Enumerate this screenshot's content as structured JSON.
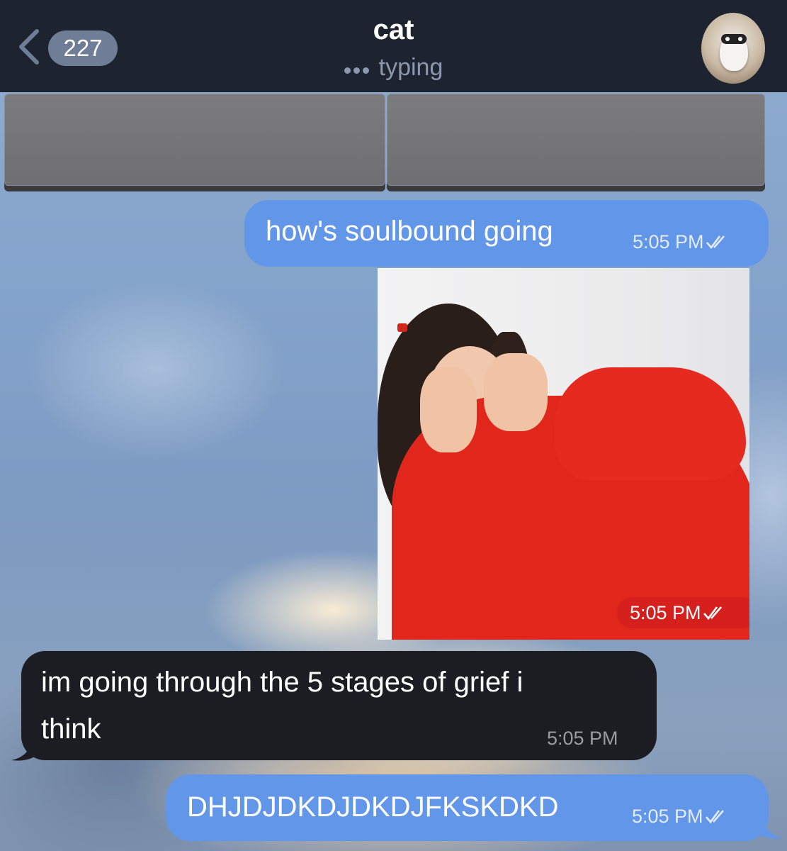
{
  "header": {
    "back_badge": "227",
    "title": "cat",
    "status": "typing"
  },
  "keyboard": {
    "buttons": [
      "",
      ""
    ]
  },
  "messages": [
    {
      "direction": "outgoing",
      "type": "text",
      "text": "how's soulbound going",
      "time": "5:05 PM",
      "read": true
    },
    {
      "direction": "outgoing",
      "type": "photo",
      "time": "5:05 PM",
      "read": true
    },
    {
      "direction": "incoming",
      "type": "text",
      "lines": [
        "im going through the 5 stages of grief i",
        "think"
      ],
      "time": "5:05 PM"
    },
    {
      "direction": "outgoing",
      "type": "text",
      "text": "DHJDJDKDJDKDJFKSKDKD",
      "time": "5:05 PM",
      "read": true
    }
  ],
  "colors": {
    "header_bg": "#1e2330",
    "outgoing_bubble": "#6196e8",
    "incoming_bubble": "#1c1d22",
    "badge_bg": "#6f7d96"
  },
  "icons": [
    "back-chevron-icon",
    "typing-dots-icon",
    "avatar",
    "double-check-icon"
  ]
}
